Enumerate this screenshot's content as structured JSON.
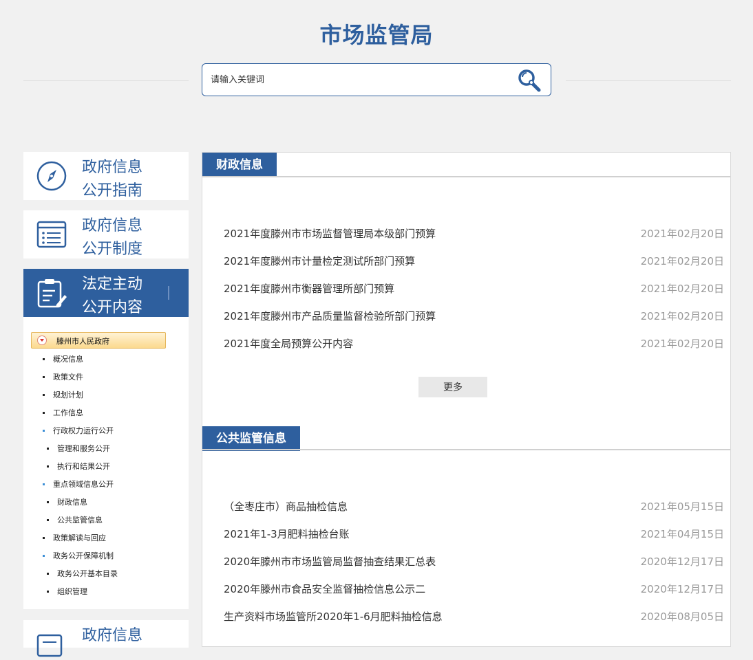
{
  "header": {
    "title": "市场监管局"
  },
  "search": {
    "placeholder": "请输入关键词"
  },
  "sidebar": {
    "cards": [
      {
        "line1": "政府信息",
        "line2": "公开指南",
        "icon": "compass-icon"
      },
      {
        "line1": "政府信息",
        "line2": "公开制度",
        "icon": "list-document-icon"
      },
      {
        "line1": "法定主动",
        "line2": "公开内容",
        "icon": "clipboard-edit-icon"
      }
    ],
    "tree": {
      "root": "滕州市人民政府",
      "items": [
        {
          "label": "概况信息"
        },
        {
          "label": "政策文件"
        },
        {
          "label": "规划计划"
        },
        {
          "label": "工作信息"
        },
        {
          "label": "行政权力运行公开"
        },
        {
          "label": "管理和服务公开"
        },
        {
          "label": "执行和结果公开"
        },
        {
          "label": "重点领域信息公开"
        },
        {
          "label": "财政信息"
        },
        {
          "label": "公共监管信息"
        },
        {
          "label": "政策解读与回应"
        },
        {
          "label": "政务公开保障机制"
        },
        {
          "label": "政务公开基本目录"
        },
        {
          "label": "组织管理"
        }
      ]
    },
    "bottom_card": {
      "line1": "政府信息"
    }
  },
  "main": {
    "sections": [
      {
        "title": "财政信息",
        "more": "更多",
        "items": [
          {
            "title": "2021年度滕州市市场监督管理局本级部门预算",
            "date": "2021年02月20日"
          },
          {
            "title": "2021年度滕州市计量检定测试所部门预算",
            "date": "2021年02月20日"
          },
          {
            "title": "2021年度滕州市衡器管理所部门预算",
            "date": "2021年02月20日"
          },
          {
            "title": "2021年度滕州市产品质量监督检验所部门预算",
            "date": "2021年02月20日"
          },
          {
            "title": "2021年度全局预算公开内容",
            "date": "2021年02月20日"
          }
        ]
      },
      {
        "title": "公共监管信息",
        "items": [
          {
            "title": "（全枣庄市）商品抽检信息",
            "date": "2021年05月15日"
          },
          {
            "title": "2021年1-3月肥料抽检台账",
            "date": "2021年04月15日"
          },
          {
            "title": "2020年滕州市市场监管局监督抽查结果汇总表",
            "date": "2020年12月17日"
          },
          {
            "title": "2020年滕州市食品安全监督抽检信息公示二",
            "date": "2020年12月17日"
          },
          {
            "title": "生产资料市场监管所2020年1-6月肥料抽检信息",
            "date": "2020年08月05日"
          }
        ]
      }
    ]
  },
  "colors": {
    "brand": "#2e5f9e",
    "date": "#999999",
    "tree_root_bg": "#fbd98e"
  }
}
